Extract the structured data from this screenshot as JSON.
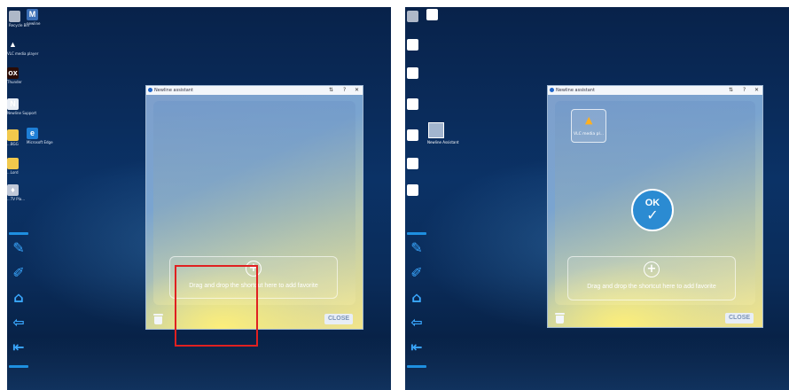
{
  "window": {
    "title": "Newline assistant",
    "controls": [
      "⇅",
      "?",
      "✕"
    ],
    "drop_hint": "Drag and drop the shortcut here to add favorite",
    "close_label": "CLOSE"
  },
  "left_desktop_icons": [
    {
      "icon": "recycle-bin-icon",
      "label": "Recycle Bin"
    },
    {
      "icon": "newline-app-icon",
      "label": "newline"
    },
    {
      "icon": "vlc-icon",
      "label": "VLC media player"
    },
    {
      "icon": "thunder-icon",
      "label": "Thunder"
    },
    {
      "icon": "newline-n-icon",
      "label": "Newline Support"
    },
    {
      "icon": "folder-icon",
      "label": "...BGG"
    },
    {
      "icon": "edge-icon",
      "label": "Microsoft Edge"
    },
    {
      "icon": "folder-icon",
      "label": "...Lord"
    },
    {
      "icon": "app-icon",
      "label": "...TV Pla..."
    }
  ],
  "right_desktop_icons": [
    {
      "icon": "recycle-bin-icon",
      "label": ""
    },
    {
      "icon": "document-icon",
      "label": ""
    }
  ],
  "right_favorite": {
    "label": "VLC media pl...",
    "icon": "vlc-icon"
  },
  "ok_badge": {
    "text": "OK",
    "check": "✓"
  },
  "drag_ghost": {
    "label": "Newline Assistant"
  },
  "toolbar_icons": [
    "edit-note-icon",
    "annotate-icon",
    "home-icon",
    "back-arrow-icon",
    "signpost-icon"
  ]
}
